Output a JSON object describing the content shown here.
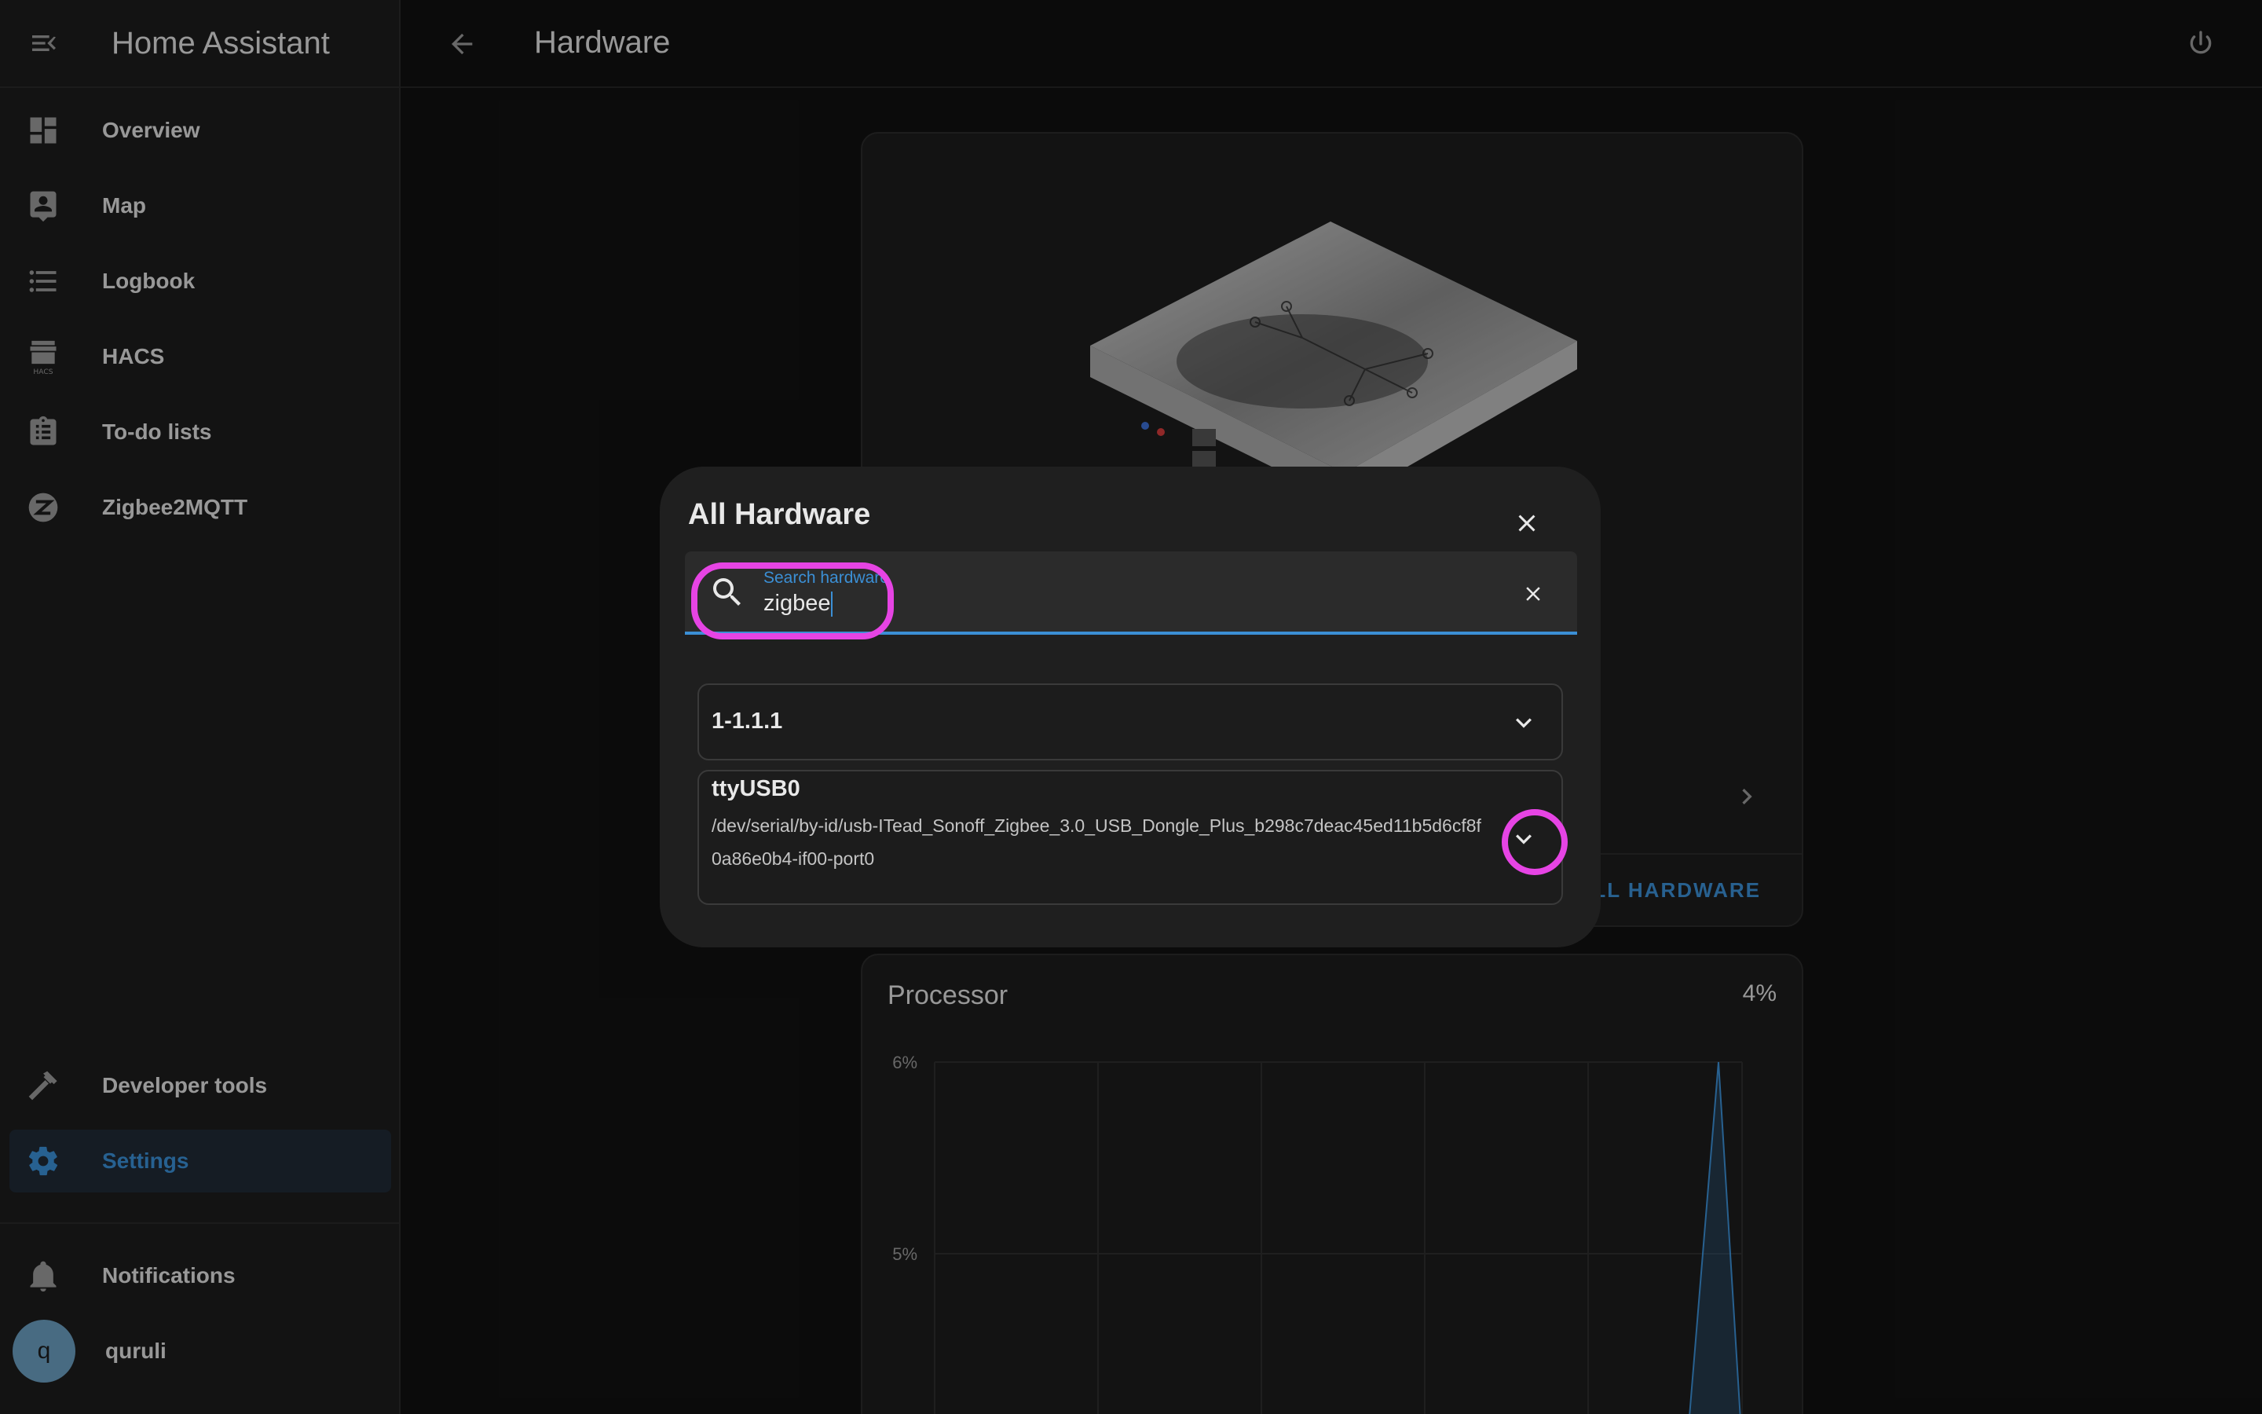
{
  "app": {
    "title": "Home Assistant"
  },
  "sidebar": {
    "items": [
      {
        "label": "Overview",
        "icon": "dashboard-icon"
      },
      {
        "label": "Map",
        "icon": "map-account-icon"
      },
      {
        "label": "Logbook",
        "icon": "list-icon"
      },
      {
        "label": "HACS",
        "icon": "hacs-icon"
      },
      {
        "label": "To-do lists",
        "icon": "clipboard-list-icon"
      },
      {
        "label": "Zigbee2MQTT",
        "icon": "zigbee-icon"
      }
    ],
    "bottom_items": [
      {
        "label": "Developer tools",
        "icon": "hammer-icon"
      },
      {
        "label": "Settings",
        "icon": "gear-icon",
        "active": true
      }
    ],
    "notifications": {
      "label": "Notifications"
    },
    "user": {
      "initial": "q",
      "name": "quruli"
    },
    "hacs_icon_text": "HACS"
  },
  "header": {
    "title": "Hardware"
  },
  "hardware_card": {
    "link_text": "ALL HARDWARE"
  },
  "processor": {
    "title": "Processor",
    "value": "4%"
  },
  "chart_data": {
    "type": "line",
    "title": "Processor",
    "y_ticks": [
      "6%",
      "5%"
    ],
    "ylim": [
      4.4,
      6
    ],
    "series": [
      {
        "values": [
          4,
          4,
          4,
          4,
          4,
          4,
          6,
          4
        ]
      }
    ],
    "grid": true,
    "color": "#3b8fd5"
  },
  "dialog": {
    "title": "All Hardware",
    "search": {
      "label": "Search hardware",
      "value": "zigbee"
    },
    "items": [
      {
        "title": "1-1.1.1"
      },
      {
        "title": "ttyUSB0",
        "path": "/dev/serial/by-id/usb-ITead_Sonoff_Zigbee_3.0_USB_Dongle_Plus_b298c7deac45ed11b5d6cf8f0a86e0b4-if00-port0"
      }
    ]
  },
  "colors": {
    "accent": "#3b8fd5",
    "annotation": "#e644e4",
    "background": "#111111",
    "sidebar": "#1c1c1c"
  }
}
